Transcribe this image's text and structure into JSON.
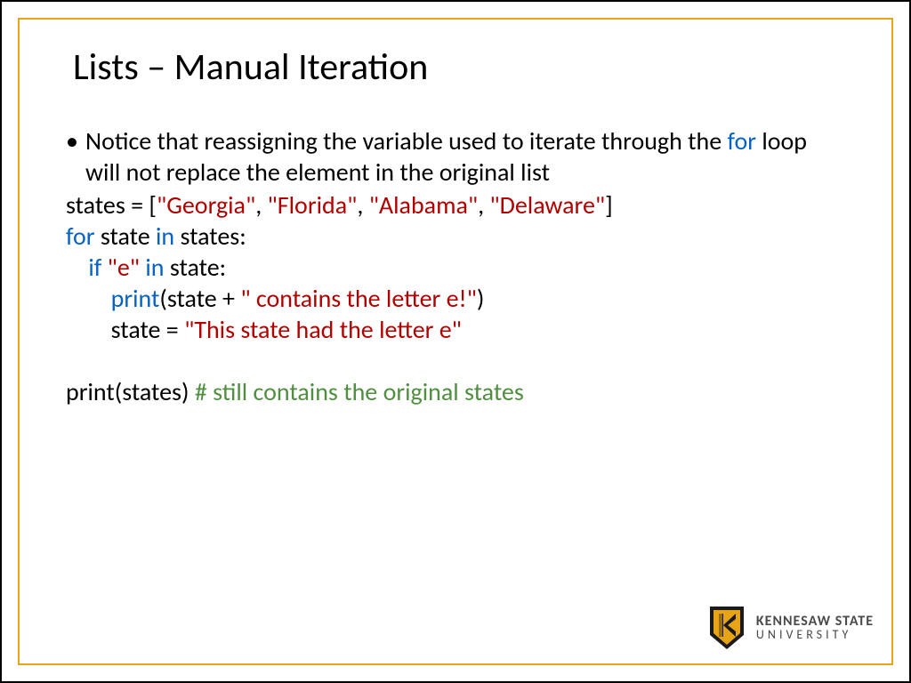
{
  "title": "Lists – Manual Iteration",
  "bullet": {
    "pre": "Notice that reassigning the variable used to iterate through the ",
    "kw": "for",
    "post": " loop will not replace the element in the original list"
  },
  "code": {
    "l1": {
      "a": "states = [",
      "s1": "\"Georgia\"",
      "c1": ", ",
      "s2": "\"Florida\"",
      "c2": ", ",
      "s3": "\"Alabama\"",
      "c3": ", ",
      "s4": "\"Delaware\"",
      "b": "]"
    },
    "l2": {
      "for": "for",
      "a": " state ",
      "in": "in",
      "b": " states:"
    },
    "l3": {
      "pad": "    ",
      "if": "if ",
      "s": "\"e\"",
      "sp": " ",
      "in": "in",
      "b": " state:"
    },
    "l4": {
      "pad": "        ",
      "print": "print",
      "a": "(state + ",
      "s": "\" contains the letter e!\"",
      "b": ")"
    },
    "l5": {
      "pad": "        ",
      "a": "state = ",
      "s": "\"This state had the letter e\""
    },
    "l6": {
      "a": "print(states) ",
      "c": "# still contains the original states"
    }
  },
  "logo": {
    "line1": "KENNESAW STATE",
    "line2": "UNIVERSITY"
  }
}
